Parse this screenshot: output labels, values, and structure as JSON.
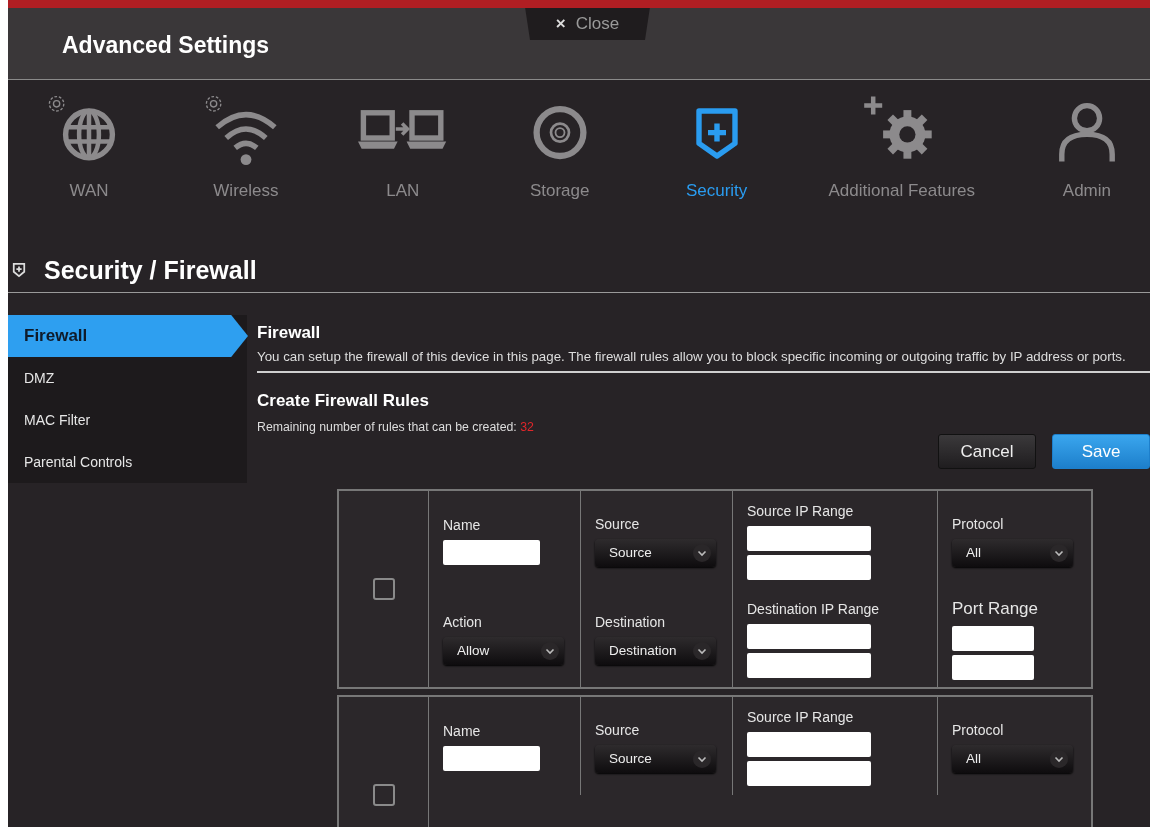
{
  "window": {
    "title": "Advanced Settings",
    "close_label": "Close",
    "close_glyph": "×"
  },
  "nav": [
    {
      "label": "WAN",
      "kind": "wan",
      "selected": false
    },
    {
      "label": "Wireless",
      "kind": "wireless",
      "selected": false
    },
    {
      "label": "LAN",
      "kind": "lan",
      "selected": false
    },
    {
      "label": "Storage",
      "kind": "storage",
      "selected": false
    },
    {
      "label": "Security",
      "kind": "security",
      "selected": true
    },
    {
      "label": "Additional Features",
      "kind": "features",
      "selected": false
    },
    {
      "label": "Admin",
      "kind": "admin",
      "selected": false
    }
  ],
  "section_title": "Security / Firewall",
  "sidebar": [
    {
      "label": "Firewall",
      "selected": true
    },
    {
      "label": "DMZ",
      "selected": false
    },
    {
      "label": "MAC Filter",
      "selected": false
    },
    {
      "label": "Parental Controls",
      "selected": false
    }
  ],
  "content": {
    "title": "Firewall",
    "description": "You can setup the firewall of this device in this page. The firewall rules allow you to block specific incoming or outgoing traffic by IP address or ports.",
    "rules_title": "Create Firewall Rules",
    "remaining_label": "Remaining number of rules that can be created:",
    "remaining_count": "32"
  },
  "buttons": [
    {
      "label": "Cancel",
      "kind": "secondary"
    },
    {
      "label": "Save",
      "kind": "primary"
    }
  ],
  "rules": [
    {
      "checked": false,
      "top": [
        {
          "kind": "text",
          "label": "Name"
        },
        {
          "kind": "select",
          "label": "Source",
          "value": "Source"
        },
        {
          "kind": "range",
          "label": "Source IP Range"
        },
        {
          "kind": "select",
          "label": "Protocol",
          "value": "All"
        }
      ],
      "bottom": [
        {
          "kind": "select",
          "label": "Action",
          "value": "Allow"
        },
        {
          "kind": "select",
          "label": "Destination",
          "value": "Destination"
        },
        {
          "kind": "range",
          "label": "Destination IP Range"
        },
        {
          "kind": "port_range",
          "label": "Port Range"
        }
      ]
    },
    {
      "checked": false,
      "top": [
        {
          "kind": "text",
          "label": "Name"
        },
        {
          "kind": "select",
          "label": "Source",
          "value": "Source"
        },
        {
          "kind": "range",
          "label": "Source IP Range"
        },
        {
          "kind": "select",
          "label": "Protocol",
          "value": "All"
        }
      ]
    }
  ]
}
